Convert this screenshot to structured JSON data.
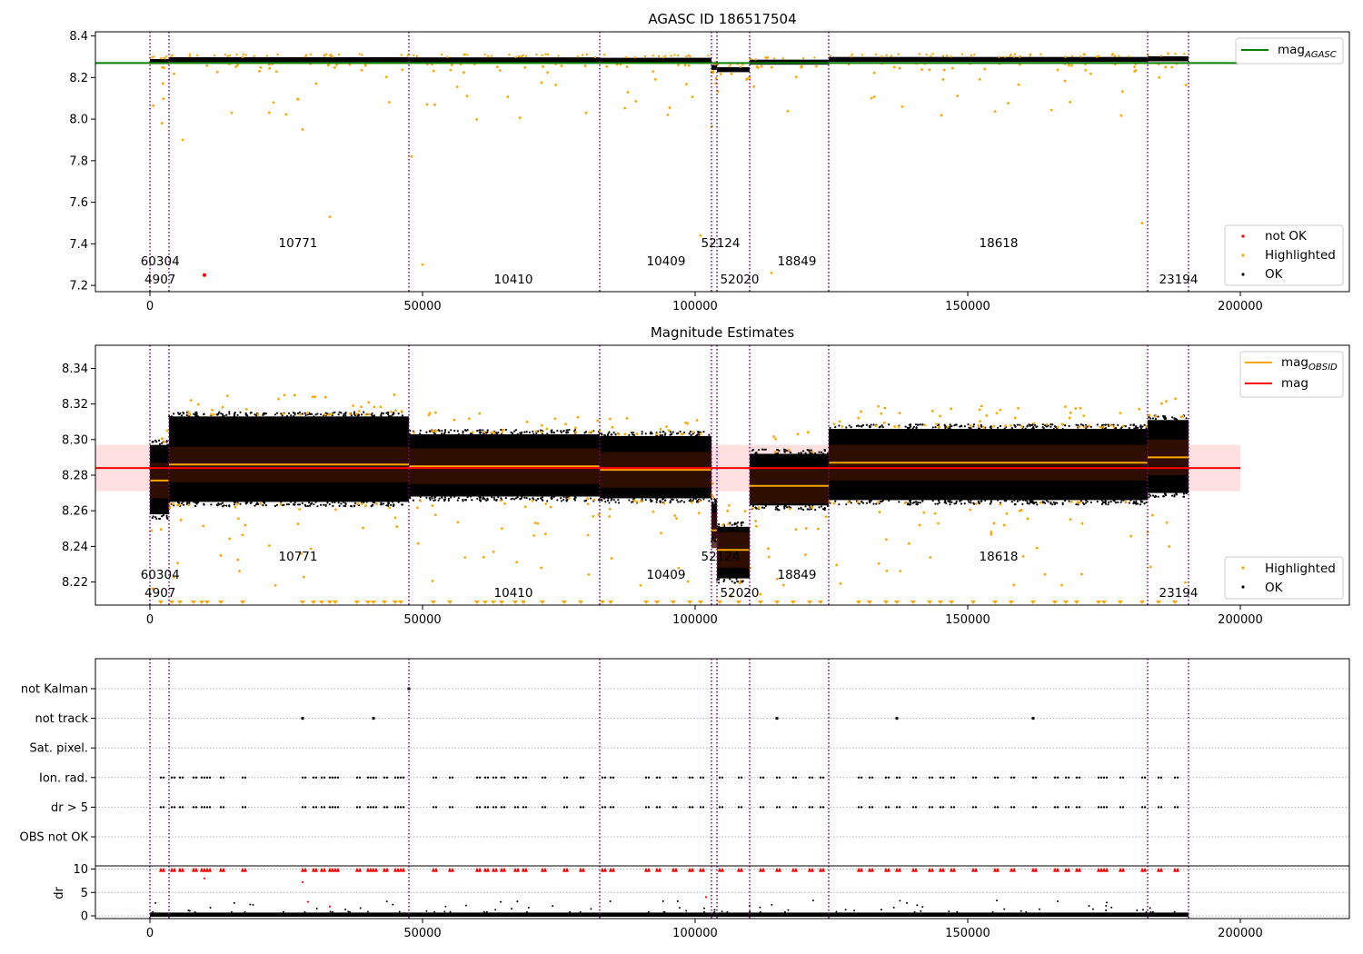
{
  "panels": {
    "top": {
      "title": "AGASC ID 186517504",
      "xlim": [
        -10000,
        220000
      ],
      "ylim": [
        7.17,
        8.42
      ],
      "yticks": [
        "7.2",
        "7.4",
        "7.6",
        "7.8",
        "8.0",
        "8.2",
        "8.4"
      ],
      "xticks": [
        "0",
        "50000",
        "100000",
        "150000",
        "200000"
      ],
      "legend_line": {
        "label": "mag",
        "sub": "AGASC",
        "color": "#008000"
      },
      "legend_points": [
        {
          "label": "not OK",
          "color": "#ff0000"
        },
        {
          "label": "Highlighted",
          "color": "#ffa500"
        },
        {
          "label": "OK",
          "color": "#000000"
        }
      ]
    },
    "middle": {
      "title": "Magnitude Estimates",
      "xlim": [
        -10000,
        220000
      ],
      "ylim": [
        8.207,
        8.353
      ],
      "yticks": [
        "8.22",
        "8.24",
        "8.26",
        "8.28",
        "8.30",
        "8.32",
        "8.34"
      ],
      "xticks": [
        "0",
        "50000",
        "100000",
        "150000",
        "200000"
      ],
      "legend_lines": [
        {
          "label": "mag",
          "sub": "OBSID",
          "color": "#ffa500"
        },
        {
          "label": "mag",
          "sub": "",
          "color": "#ff0000"
        }
      ],
      "legend_points": [
        {
          "label": "Highlighted",
          "color": "#ffa500"
        },
        {
          "label": "OK",
          "color": "#000000"
        }
      ]
    },
    "flags": {
      "rows": [
        "not Kalman",
        "not track",
        "Sat. pixel.",
        "Ion. rad.",
        "dr > 5",
        "OBS not OK"
      ]
    },
    "dr": {
      "ylabel": "dr",
      "yticks": [
        "0",
        "5",
        "10"
      ],
      "xticks": [
        "0",
        "50000",
        "100000",
        "150000",
        "200000"
      ]
    }
  },
  "obsid_labels": [
    {
      "text": "60304",
      "x": 200,
      "level": 1
    },
    {
      "text": "4907",
      "x": 200,
      "level": 0
    },
    {
      "text": "10771",
      "x": 25500,
      "level": 2
    },
    {
      "text": "10410",
      "x": 65000,
      "level": 0
    },
    {
      "text": "10409",
      "x": 93000,
      "level": 1
    },
    {
      "text": "52124",
      "x": 103000,
      "level": 2
    },
    {
      "text": "52020",
      "x": 106500,
      "level": 0
    },
    {
      "text": "18849",
      "x": 117000,
      "level": 1
    },
    {
      "text": "18618",
      "x": 154000,
      "level": 2
    },
    {
      "text": "23194",
      "x": 187000,
      "level": 0
    }
  ],
  "chart_data": {
    "type": "scatter",
    "title": "AGASC ID 186517504",
    "x_range": [
      -10000,
      220000
    ],
    "obsid_boundaries": [
      0,
      3500,
      47500,
      82500,
      103000,
      104000,
      110000,
      124500,
      183000,
      190500
    ],
    "mag_agasc": 8.27,
    "mag": 8.284,
    "mag_band": [
      8.271,
      8.297
    ],
    "segments": [
      {
        "obsid": "4907",
        "x": [
          0,
          3500
        ],
        "mag_obsid": 8.277,
        "ok_range": [
          8.258,
          8.297
        ]
      },
      {
        "obsid": "60304",
        "x": [
          3500,
          47500
        ],
        "mag_obsid": 8.286,
        "ok_range": [
          8.265,
          8.313
        ]
      },
      {
        "obsid": "10771",
        "x": [
          47500,
          82500
        ],
        "mag_obsid": 8.285,
        "ok_range": [
          8.268,
          8.303
        ]
      },
      {
        "obsid": "10410",
        "x": [
          82500,
          103000
        ],
        "mag_obsid": 8.283,
        "ok_range": [
          8.267,
          8.302
        ]
      },
      {
        "obsid": "10409",
        "x": [
          103000,
          104000
        ],
        "mag_obsid": 8.249,
        "ok_range": [
          8.245,
          8.264
        ]
      },
      {
        "obsid": "52124",
        "x": [
          104000,
          110000
        ],
        "mag_obsid": 8.238,
        "ok_range": [
          8.222,
          8.251
        ]
      },
      {
        "obsid": "52020",
        "x": [
          110000,
          124500
        ],
        "mag_obsid": 8.274,
        "ok_range": [
          8.263,
          8.292
        ]
      },
      {
        "obsid": "18849",
        "x": [
          124500,
          183000
        ],
        "mag_obsid": 8.287,
        "ok_range": [
          8.266,
          8.306
        ]
      },
      {
        "obsid": "18618",
        "x": [
          183000,
          190500
        ],
        "mag_obsid": 8.29,
        "ok_range": [
          8.27,
          8.311
        ]
      }
    ],
    "not_ok_points": [
      {
        "x": 10000,
        "y": 7.25
      }
    ],
    "flag_markers_x": [
      2000,
      4000,
      5500,
      8000,
      9500,
      10500,
      13000,
      17000,
      28000,
      30000,
      31500,
      33000,
      34000,
      38000,
      40000,
      41000,
      43000,
      45000,
      46000,
      52000,
      55000,
      60000,
      61500,
      63000,
      64500,
      67000,
      68500,
      72000,
      76000,
      79000,
      83000,
      84500,
      91000,
      93000,
      96000,
      99000,
      101000,
      104500,
      108000,
      112000,
      115000,
      118000,
      121000,
      123000,
      130000,
      132000,
      135000,
      137000,
      140000,
      143000,
      145000,
      147000,
      151000,
      155000,
      158000,
      162000,
      166000,
      168000,
      170000,
      174000,
      175000,
      178000,
      182000,
      185000,
      188000
    ]
  }
}
